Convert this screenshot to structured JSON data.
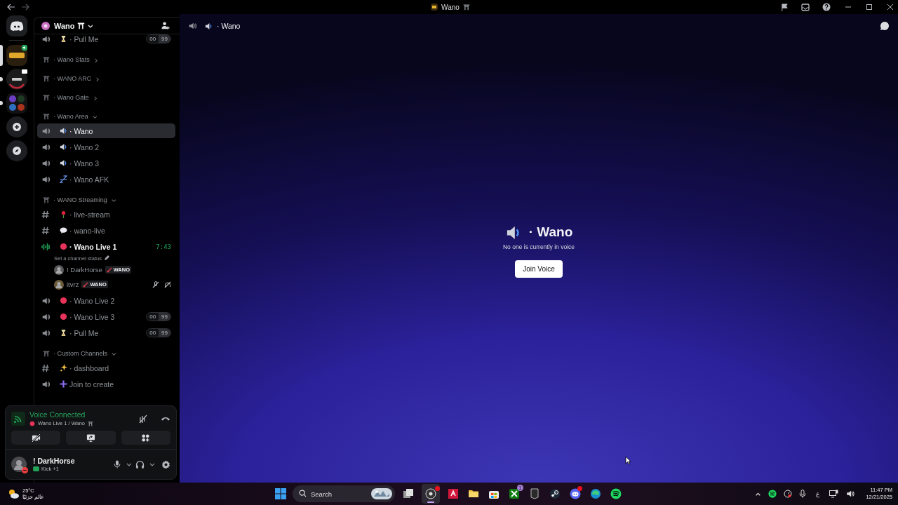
{
  "window": {
    "title": "Wano"
  },
  "servers": [
    {
      "selected": true
    },
    {
      "selected": false
    },
    {
      "selected": false
    }
  ],
  "sidebar": {
    "server_name": "Wano",
    "items": [
      {
        "kind": "voice",
        "name": "· Pull Me",
        "selected": false,
        "connected": false,
        "user_count": "00",
        "user_limit": "99"
      },
      {
        "kind": "category",
        "name": "· Wano Stats",
        "expanded": false
      },
      {
        "kind": "category",
        "name": "· WANO ARC",
        "expanded": false
      },
      {
        "kind": "category",
        "name": "· Wano Gate",
        "expanded": false
      },
      {
        "kind": "category",
        "name": "· Wano Area",
        "expanded": true,
        "children": [
          {
            "kind": "voice",
            "name": "· Wano",
            "selected": true,
            "connected": false
          },
          {
            "kind": "voice",
            "name": "· Wano 2",
            "selected": false,
            "connected": false
          },
          {
            "kind": "voice",
            "name": "· Wano 3",
            "selected": false,
            "connected": false
          },
          {
            "kind": "voice",
            "name": "· Wano AFK",
            "selected": false,
            "connected": false
          }
        ]
      },
      {
        "kind": "category",
        "name": "· WANO Streaming",
        "expanded": true,
        "children": [
          {
            "kind": "text",
            "name": "· live-stream",
            "selected": false,
            "connected": false
          },
          {
            "kind": "text",
            "name": "· wano-live",
            "selected": false,
            "connected": false
          },
          {
            "kind": "voice",
            "name": "· Wano Live 1",
            "selected": false,
            "connected": true,
            "timer": "7:43",
            "status": "Set a channel status",
            "users": [
              {
                "name": "! DarkHorse",
                "tag": "WANO",
                "muted": false,
                "deafened": false
              },
              {
                "name": "itvrz",
                "tag": "WANO",
                "muted": true,
                "deafened": true
              }
            ]
          },
          {
            "kind": "voice",
            "name": "· Wano Live 2",
            "selected": false,
            "connected": false
          },
          {
            "kind": "voice",
            "name": "· Wano Live 3",
            "selected": false,
            "connected": false,
            "user_count": "00",
            "user_limit": "99"
          },
          {
            "kind": "voice",
            "name": "· Pull Me",
            "selected": false,
            "connected": false,
            "user_count": "00",
            "user_limit": "99"
          }
        ]
      },
      {
        "kind": "category",
        "name": "· Custom Channels",
        "expanded": true,
        "children": [
          {
            "kind": "text",
            "name": "· dashboard",
            "selected": false,
            "connected": false
          },
          {
            "kind": "voice",
            "name": "Join to create",
            "selected": false,
            "connected": false
          }
        ]
      }
    ]
  },
  "voice_panel": {
    "title": "Voice Connected",
    "channel": "Wano Live 1 / Wano"
  },
  "user_panel": {
    "name": "! DarkHorse",
    "activity": "Kick +1"
  },
  "main": {
    "channel": "· Wano",
    "empty_title": "· Wano",
    "empty_text": "No one is currently in voice",
    "button": "Join Voice"
  },
  "taskbar": {
    "temperature": "25°C",
    "weather": "غائم جزئيًا",
    "search_placeholder": "Search",
    "apps": [
      {
        "selected": false,
        "alert": false
      },
      {
        "selected": true,
        "alert": true
      },
      {
        "selected": false,
        "alert": false
      },
      {
        "selected": false,
        "alert": false
      },
      {
        "selected": false,
        "alert": false
      },
      {
        "selected": false,
        "alert": false,
        "badge": "1"
      },
      {
        "selected": false,
        "alert": false
      },
      {
        "selected": false,
        "alert": false
      },
      {
        "selected": false,
        "alert": true
      },
      {
        "selected": false,
        "alert": false
      },
      {
        "selected": false,
        "alert": false
      }
    ],
    "keyboard": "ع",
    "time": "11:47 PM",
    "date": "12/21/2025"
  }
}
